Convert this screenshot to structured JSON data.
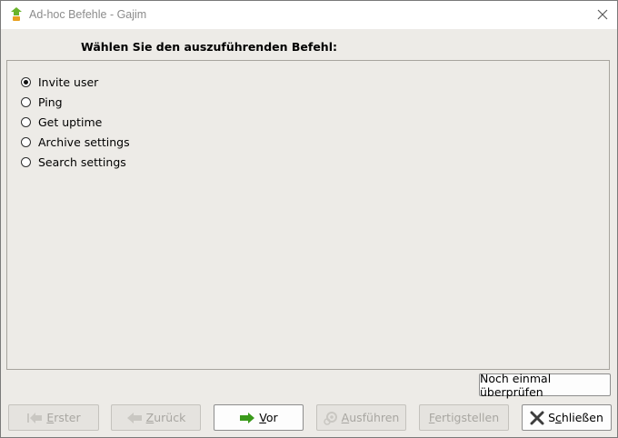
{
  "window": {
    "title": "Ad-hoc Befehle - Gajim"
  },
  "heading": "Wählen Sie den auszuführenden Befehl:",
  "commands": [
    {
      "label": "Invite user",
      "selected": true
    },
    {
      "label": "Ping",
      "selected": false
    },
    {
      "label": "Get uptime",
      "selected": false
    },
    {
      "label": "Archive settings",
      "selected": false
    },
    {
      "label": "Search settings",
      "selected": false
    }
  ],
  "recheck_button": "Noch einmal überprüfen",
  "buttons": {
    "first": {
      "mnemonic": "E",
      "rest": "rster",
      "enabled": false,
      "icon": "go-first-icon"
    },
    "back": {
      "mnemonic": "Z",
      "rest": "urück",
      "enabled": false,
      "icon": "go-back-icon"
    },
    "forward": {
      "mnemonic": "V",
      "rest": "or",
      "enabled": true,
      "icon": "go-forward-icon"
    },
    "execute": {
      "mnemonic": "A",
      "rest": "usführen",
      "enabled": false,
      "icon": "execute-icon"
    },
    "finish": {
      "mnemonic": "F",
      "rest": "ertigstellen",
      "enabled": false
    },
    "close": {
      "prefix": "S",
      "mnemonic": "c",
      "rest": "hließen",
      "enabled": true,
      "icon": "close-icon"
    }
  },
  "colors": {
    "window_bg": "#edebe7",
    "forward_arrow": "#3a9a1a",
    "app_icon_green": "#6ab42a",
    "app_icon_orange": "#e8a020"
  }
}
